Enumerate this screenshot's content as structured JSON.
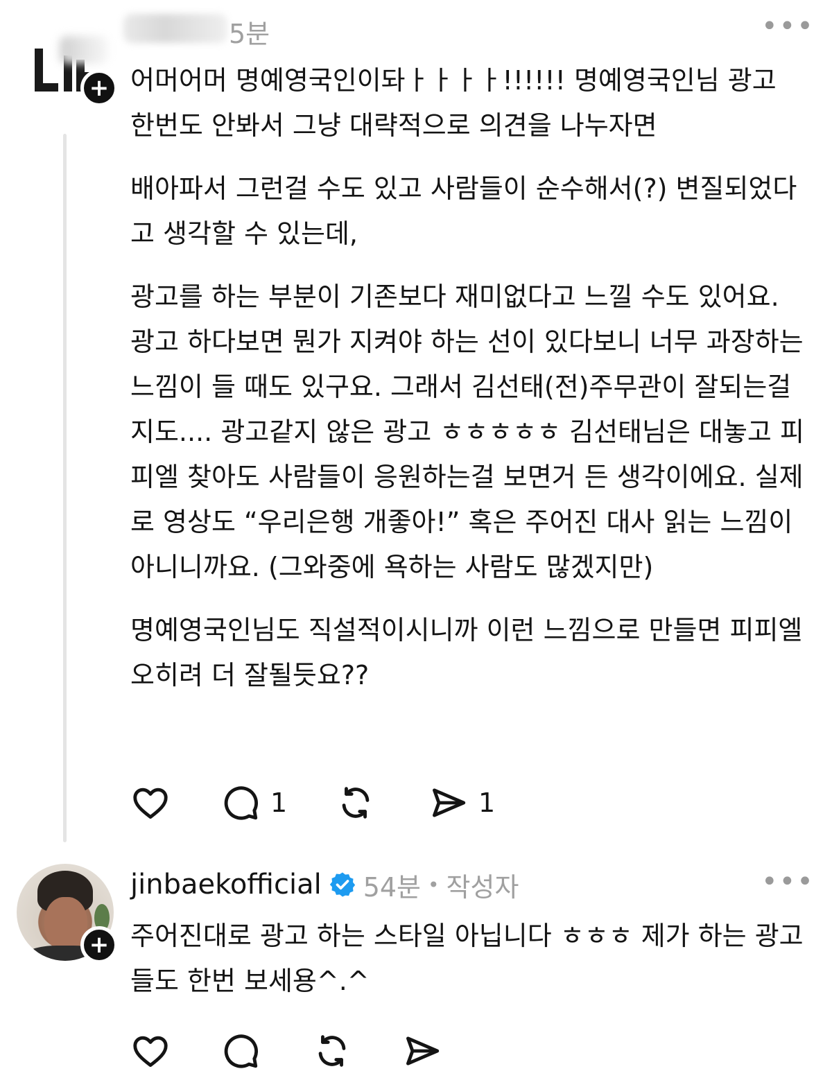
{
  "post1": {
    "avatar": {
      "initials": "Lil"
    },
    "time": "5분",
    "paragraphs": [
      "어머어머 명예영국인이돠ㅏㅏㅏㅏ!!!!!! 명예영국인님 광고 한번도 안봐서 그냥 대략적으로 의견을 나누자면",
      "배아파서 그런걸 수도 있고 사람들이 순수해서(?) 변질되었다고 생각할 수 있는데,",
      "광고를 하는 부분이 기존보다 재미없다고 느낄 수도 있어요. 광고 하다보면 뭔가 지켜야 하는 선이 있다보니 너무 과장하는 느낌이 들 때도 있구요. 그래서 김선태(전)주무관이 잘되는걸지도.... 광고같지 않은 광고 ㅎㅎㅎㅎㅎ 김선태님은 대놓고 피피엘 찾아도 사람들이 응원하는걸 보면거 든 생각이에요. 실제로 영상도 “우리은행 개좋아!” 혹은 주어진 대사 읽는 느낌이 아니니까요. (그와중에 욕하는 사람도 많겠지만)",
      "명예영국인님도 직설적이시니까 이런 느낌으로 만들면 피피엘 오히려 더 잘될듯요??"
    ],
    "actions": {
      "like_count": "",
      "comment_count": "1",
      "repost_count": "",
      "share_count": "1"
    }
  },
  "post2": {
    "username": "jinbaekofficial",
    "time": "54분",
    "separator": "•",
    "author_tag": "작성자",
    "paragraphs": [
      "주어진대로 광고 하는 스타일 아닙니다 ㅎㅎㅎ 제가 하는 광고들도 한번 보세용^.^"
    ]
  },
  "icons": {
    "more": "more-horizontal-icon",
    "like": "heart-icon",
    "comment": "comment-icon",
    "repost": "repost-icon",
    "share": "share-icon",
    "follow": "plus-icon",
    "verified": "verified-badge-icon"
  },
  "colors": {
    "text": "#141414",
    "muted": "#a0a0a0",
    "verified": "#1d9bf0",
    "thread_line": "#e4e4e4"
  }
}
